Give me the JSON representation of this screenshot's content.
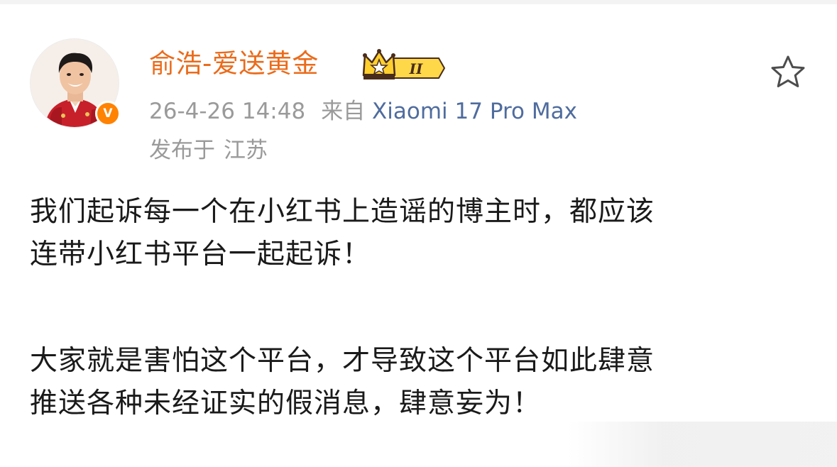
{
  "post": {
    "author": {
      "name": "俞浩-爱送黄金",
      "badge_level": "II",
      "verified_mark": "V",
      "avatar_icon": "user-avatar-photo",
      "name_color": "#ea6b1b",
      "verified_color": "#ff8200"
    },
    "meta": {
      "timestamp": "26-4-26 14:48",
      "source_prefix": "来自",
      "device": "Xiaomi 17 Pro Max",
      "location_prefix": "发布于",
      "location": "江苏",
      "device_color": "#4f6c9e"
    },
    "actions": {
      "favorite_icon": "star-outline-icon"
    },
    "content": {
      "paragraphs": [
        {
          "lines": [
            "我们起诉每一个在小红书上造谣的博主时，都应该",
            "连带小红书平台一起起诉！"
          ]
        },
        {
          "lines": [
            "大家就是害怕这个平台，才导致这个平台如此肆意",
            "推送各种未经证实的假消息，肆意妄为！"
          ]
        }
      ]
    }
  }
}
